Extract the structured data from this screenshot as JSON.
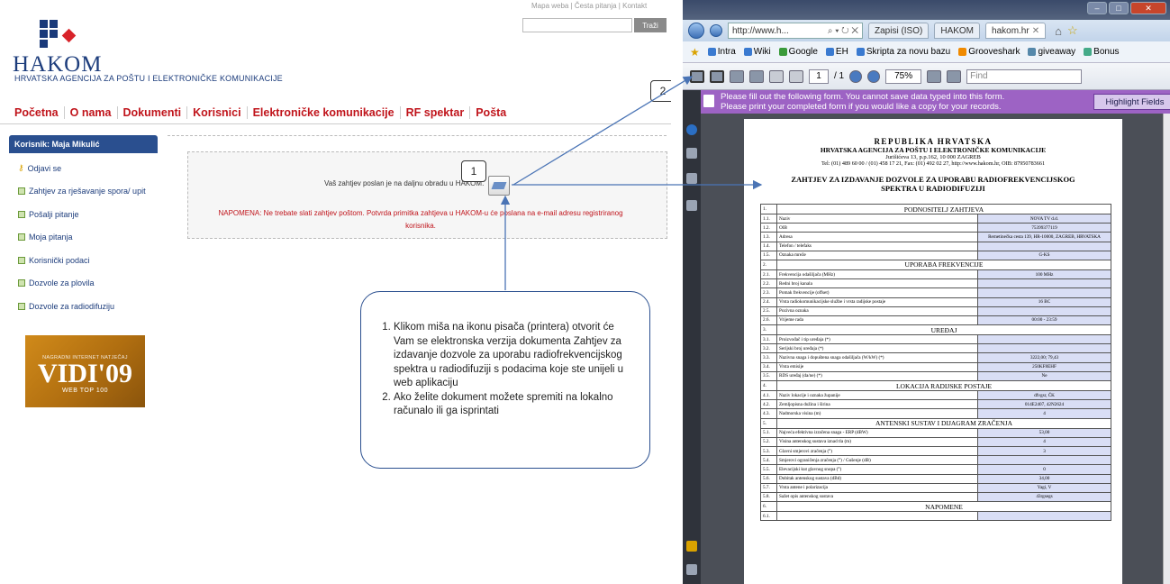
{
  "site": {
    "name": "HAKOM",
    "subtitle": "HRVATSKA AGENCIJA ZA POŠTU I ELEKTRONIČKE KOMUNIKACIJE",
    "top_links": "Mapa weba | Česta pitanja | Kontakt",
    "search_button": "Traži",
    "nav": [
      "Početna",
      "O nama",
      "Dokumenti",
      "Korisnici",
      "Elektroničke komunikacije",
      "RF spektar",
      "Pošta"
    ],
    "user_label": "Korisnik: Maja Mikulić",
    "sidebar": [
      "Odjavi se",
      "Zahtjev za rješavanje spora/ upit",
      "Pošalji pitanje",
      "Moja pitanja",
      "Korisnički podaci",
      "Dozvole za plovila",
      "Dozvole za radiodifuziju"
    ],
    "banner": {
      "small": "NAGRADNI INTERNET NATJEČAJ",
      "big": "VIDI'09",
      "web": "WEB TOP 100"
    },
    "message": "Vaš zahtjev poslan je na daljnu obradu u HAKOM.",
    "note": "NAPOMENA: Ne trebate slati zahtjev poštom. Potvrda primitka zahtjeva u HAKOM-u će poslana na e-mail adresu registriranog korisnika."
  },
  "callouts": {
    "one": "1",
    "two": "2"
  },
  "instructions": [
    "Klikom miša na ikonu pisača (printera) otvorit će Vam se elektronska verzija dokumenta Zahtjev za izdavanje dozvole za uporabu radiofrekvencijskog spektra u radiodifuziji s podacima koje ste unijeli u web aplikaciju",
    "Ako želite dokument možete spremiti na lokalno računalo ili ga isprintati"
  ],
  "browser": {
    "address": "http://www.h...",
    "tabs": [
      "Zapisi (ISO)",
      "HAKOM",
      "hakom.hr"
    ],
    "favorites": [
      "Intra",
      "Wiki",
      "Google",
      "EH",
      "Skripta za novu bazu",
      "Grooveshark",
      "giveaway",
      "Bonus"
    ],
    "page_current": "1",
    "page_total": "/ 1",
    "zoom": "75%",
    "find_placeholder": "Find",
    "form_notice_1": "Please fill out the following form. You cannot save data typed into this form.",
    "form_notice_2": "Please print your completed form if you would like a copy for your records.",
    "highlight_button": "Highlight Fields"
  },
  "document": {
    "h1": "REPUBLIKA HRVATSKA",
    "h2": "HRVATSKA AGENCIJA ZA POŠTU I ELEKTRONIČKE KOMUNIKACIJE",
    "address": "Jurišićeva 13, p.p.162, 10 000 ZAGREB",
    "contact": "Tel: (01) 489 60 00 / (01) 458 17 21, Fax: (01) 492 02 27, http://www.hakom.hr, OIB: 87950783661",
    "title": "ZAHTJEV ZA IZDAVANJE DOZVOLE ZA UPORABU RADIOFREKVENCIJSKOG SPEKTRA U RADIODIFUZIJI",
    "rows": [
      {
        "n": "1.",
        "section": "PODNOSITELJ ZAHTJEVA"
      },
      {
        "n": "1.1.",
        "label": "Naziv",
        "value": "NOVA TV d.d."
      },
      {
        "n": "1.2.",
        "label": "OIB",
        "value": "75399377119"
      },
      {
        "n": "1.3.",
        "label": "Adresa",
        "value": "Remetinečka cesta 139, HR-10000, ZAGREB, HRVATSKA"
      },
      {
        "n": "1.4.",
        "label": "Telefon / telefaks",
        "value": ""
      },
      {
        "n": "1.5.",
        "label": "Oznaka mreže",
        "value": "G-KS"
      },
      {
        "n": "2.",
        "section": "UPORABA FREKVENCIJE"
      },
      {
        "n": "2.1.",
        "label": "Frekvencija odašiljača (MHz)",
        "value": "100 MHz"
      },
      {
        "n": "2.2.",
        "label": "Redni broj kanala",
        "value": ""
      },
      {
        "n": "2.3.",
        "label": "Pomak frekvencije (offset)",
        "value": ""
      },
      {
        "n": "2.4.",
        "label": "Vrsta radiokomunikacijske službe i vrsta radijske postaje",
        "value": "16 BC"
      },
      {
        "n": "2.5.",
        "label": "Pozivna oznaka",
        "value": ""
      },
      {
        "n": "2.6.",
        "label": "Vrijeme rada",
        "value": "00:00 - 23:59"
      },
      {
        "n": "3.",
        "section": "UREĐAJ"
      },
      {
        "n": "3.1.",
        "label": "Proizvođač i tip uređaja (*)",
        "value": ""
      },
      {
        "n": "3.2.",
        "label": "Serijski broj uređaja (*)",
        "value": ""
      },
      {
        "n": "3.3.",
        "label": "Nazivna snaga i dopuštena snaga odašiljača (W/kW) (*)",
        "value": "3222,00; 79,43"
      },
      {
        "n": "3.4.",
        "label": "Vrsta emisije",
        "value": "250KF8EHF"
      },
      {
        "n": "3.5.",
        "label": "RDS uređaj (da/ne) (*)",
        "value": "Ne"
      },
      {
        "n": "4.",
        "section": "LOKACIJA RADIJSKE POSTAJE"
      },
      {
        "n": "4.1.",
        "label": "Naziv lokacije i oznaka županije",
        "value": "dfvgsr, ČK"
      },
      {
        "n": "4.2.",
        "label": "Zemljopisna dužina i širina",
        "value": "014E2407, 42N2624"
      },
      {
        "n": "4.3.",
        "label": "Nadmorska visina (m)",
        "value": "4"
      },
      {
        "n": "5.",
        "section": "ANTENSKI SUSTAV I DIJAGRAM ZRAČENJA"
      },
      {
        "n": "5.1.",
        "label": "Najveća efektivna izračena snaga - ERP (dBW)",
        "value": "53,00"
      },
      {
        "n": "5.2.",
        "label": "Visina antenskog sustava iznad tla (m)",
        "value": "4"
      },
      {
        "n": "5.3.",
        "label": "Glavni smjerovi zračenja (°)",
        "value": "3"
      },
      {
        "n": "5.4.",
        "label": "Smjerovi ograničenja zračenja (°) / Gušenje (dB)",
        "value": ""
      },
      {
        "n": "5.5.",
        "label": "Elevacijski kut glavnog snopa (°)",
        "value": "0"
      },
      {
        "n": "5.6.",
        "label": "Dobitak antenskog sustava (dBd)",
        "value": "34,00"
      },
      {
        "n": "5.7.",
        "label": "Vrsta antene i polarizacija",
        "value": "Yagi, V"
      },
      {
        "n": "5.8.",
        "label": "Sažet opis antenskog sustava",
        "value": "43rgsegs"
      },
      {
        "n": "6.",
        "section": "NAPOMENE"
      },
      {
        "n": "6.1.",
        "label": "",
        "value": ""
      }
    ]
  },
  "colors": {
    "brand_blue": "#1d3d7c",
    "nav_red": "#c0141b",
    "purple_bar": "#9d63c4",
    "field_blue": "#d9def5"
  }
}
